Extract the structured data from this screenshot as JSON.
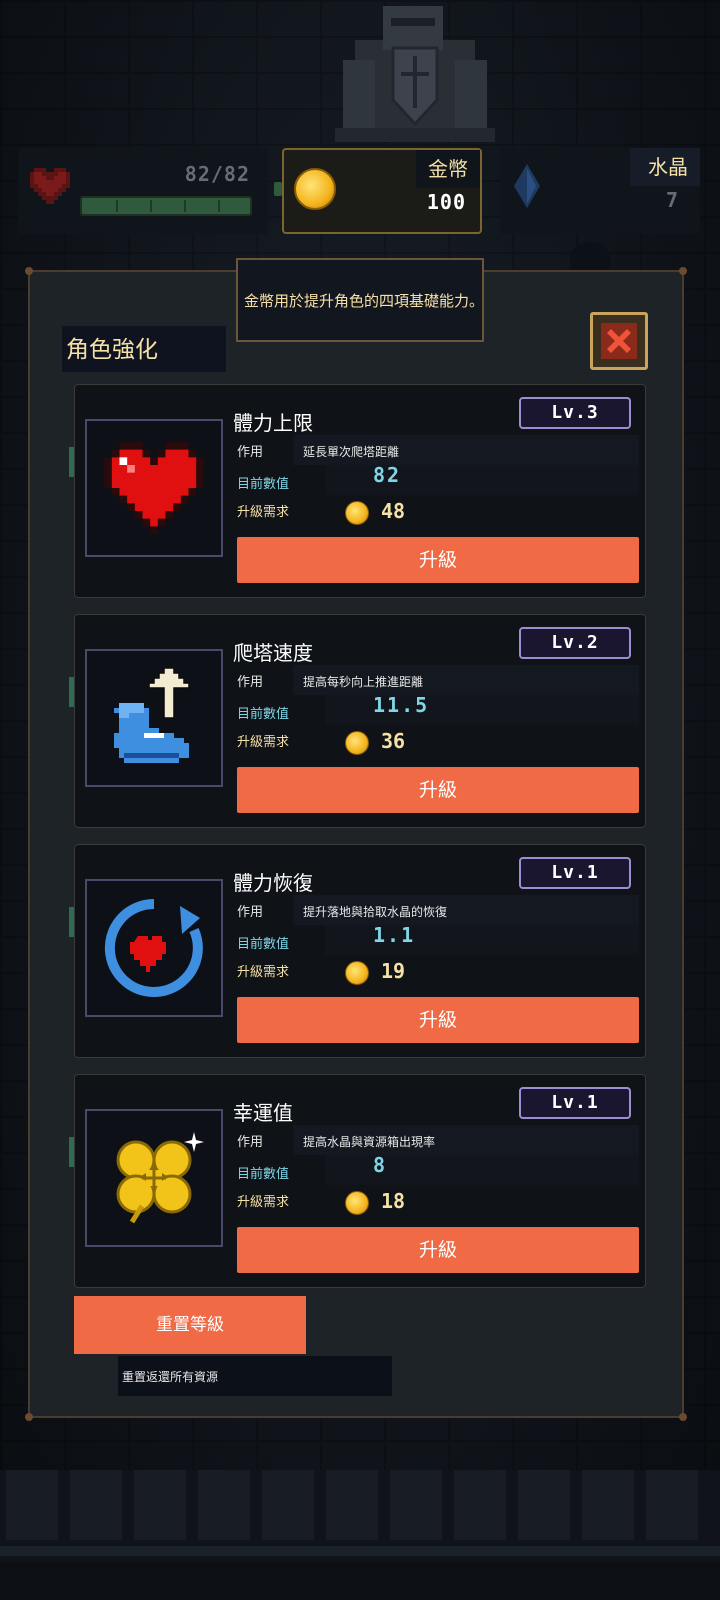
{
  "hud": {
    "hp": {
      "text": "82/82",
      "icon": "heart-icon",
      "fill": 1.0
    },
    "gold": {
      "label": "金幣",
      "value": "100",
      "icon": "coin-icon"
    },
    "crystal": {
      "label": "水晶",
      "value": "7",
      "icon": "crystal-icon"
    }
  },
  "tooltip": {
    "text": "金幣用於提升角色的四項基礎能力。"
  },
  "panel": {
    "title": "角色強化",
    "close_icon": "close-icon"
  },
  "labels": {
    "effect": "作用",
    "current": "目前數值",
    "cost": "升級需求"
  },
  "upgrades": [
    {
      "name": "體力上限",
      "level": "Lv.3",
      "effect": "延長單次爬塔距離",
      "current": "82",
      "cost": "48",
      "button": "升級",
      "icon": "heart-icon"
    },
    {
      "name": "爬塔速度",
      "level": "Lv.2",
      "effect": "提高每秒向上推進距離",
      "current": "11.5",
      "cost": "36",
      "button": "升級",
      "icon": "boot-up-arrow-icon"
    },
    {
      "name": "體力恢復",
      "level": "Lv.1",
      "effect": "提升落地與拾取水晶的恢復",
      "current": "1.1",
      "cost": "19",
      "button": "升級",
      "icon": "heart-regen-icon"
    },
    {
      "name": "幸運值",
      "level": "Lv.1",
      "effect": "提高水晶與資源箱出現率",
      "current": "8",
      "cost": "18",
      "button": "升級",
      "icon": "clover-icon"
    }
  ],
  "reset": {
    "button": "重置等級",
    "description": "重置返還所有資源"
  },
  "colors": {
    "accent_button": "#ef6a45",
    "gold_text": "#f5e0a6",
    "value_cyan": "#7fd6e8",
    "level_border": "#9a8fd0"
  }
}
